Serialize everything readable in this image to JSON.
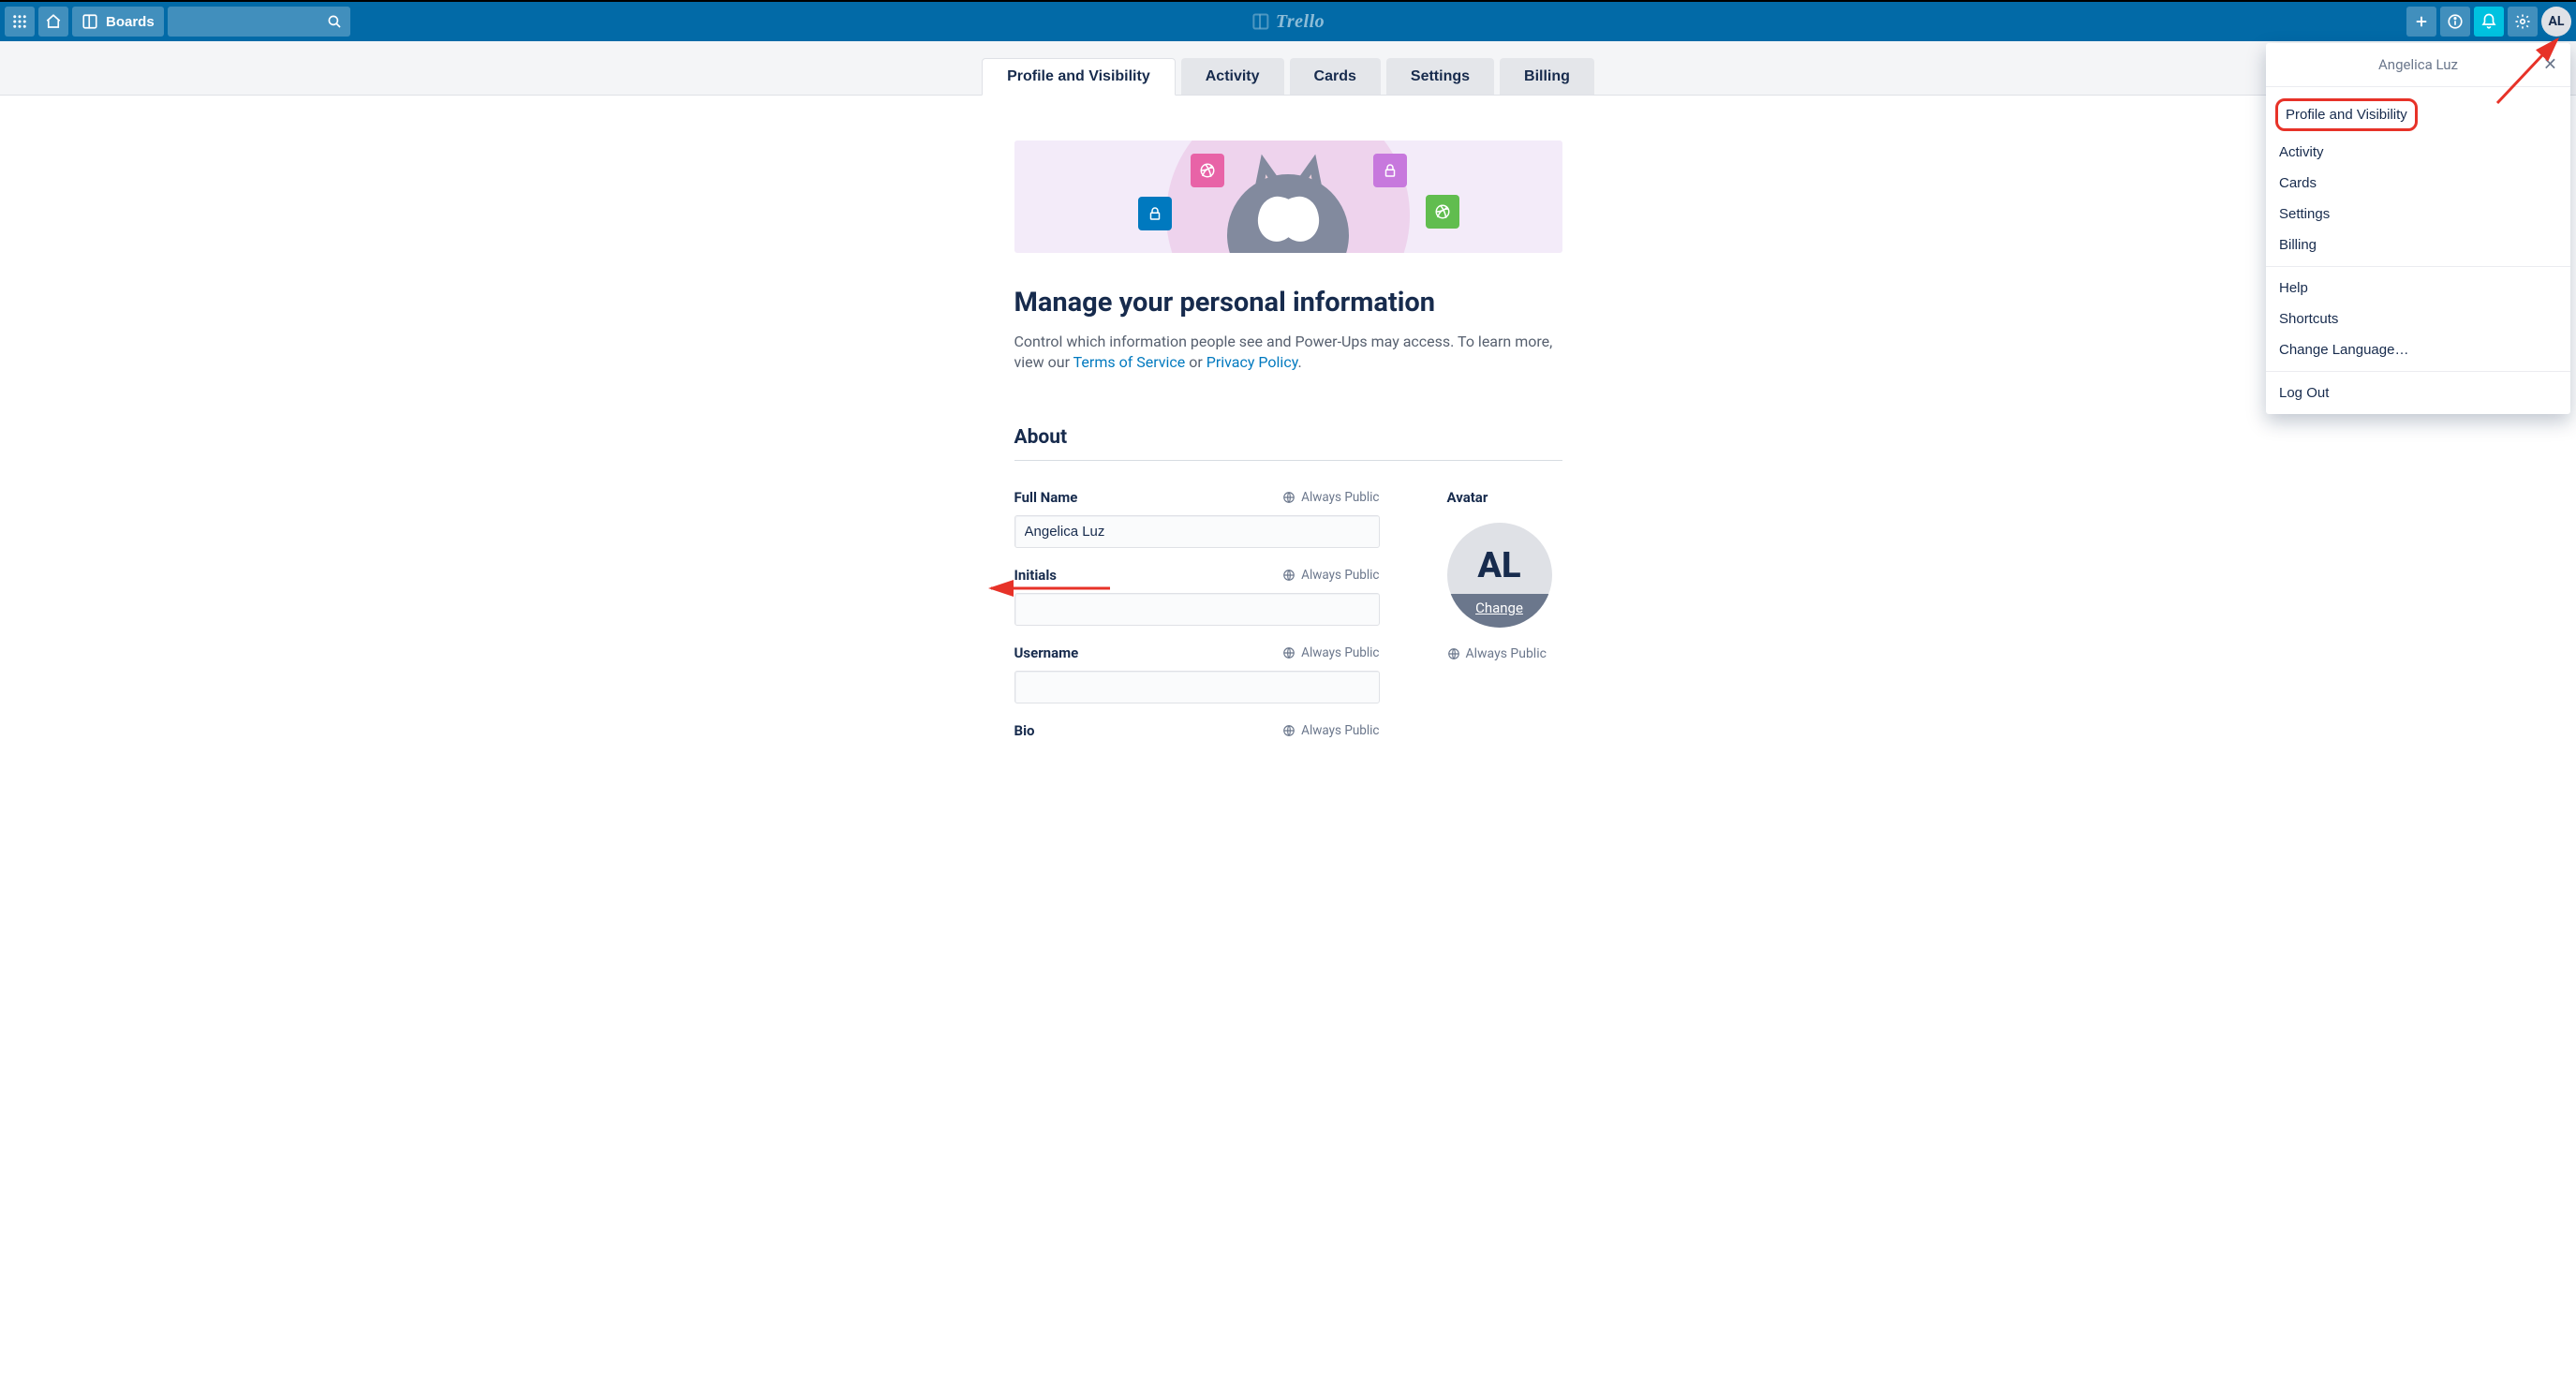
{
  "header": {
    "boards_label": "Boards",
    "logo_text": "Trello",
    "avatar_initials": "AL"
  },
  "tabs": [
    {
      "key": "profile",
      "label": "Profile and Visibility",
      "active": true
    },
    {
      "key": "activity",
      "label": "Activity",
      "active": false
    },
    {
      "key": "cards",
      "label": "Cards",
      "active": false
    },
    {
      "key": "settings",
      "label": "Settings",
      "active": false
    },
    {
      "key": "billing",
      "label": "Billing",
      "active": false
    }
  ],
  "page": {
    "title": "Manage your personal information",
    "desc_1": "Control which information people see and Power-Ups may access. To learn more, view our ",
    "tos_link": "Terms of Service",
    "desc_or": " or ",
    "pp_link": "Privacy Policy",
    "desc_dot": "."
  },
  "about": {
    "section_title": "About",
    "always_public": "Always Public",
    "full_name_label": "Full Name",
    "full_name_value": "Angelica Luz",
    "initials_label": "Initials",
    "initials_value": "",
    "username_label": "Username",
    "username_value": "",
    "bio_label": "Bio",
    "avatar_label": "Avatar",
    "avatar_initials": "AL",
    "avatar_change": "Change"
  },
  "popover": {
    "title": "Angelica Luz",
    "sections": [
      [
        {
          "key": "profile",
          "label": "Profile and Visibility",
          "highlight": true
        },
        {
          "key": "activity",
          "label": "Activity"
        },
        {
          "key": "cards",
          "label": "Cards"
        },
        {
          "key": "settings",
          "label": "Settings"
        },
        {
          "key": "billing",
          "label": "Billing"
        }
      ],
      [
        {
          "key": "help",
          "label": "Help"
        },
        {
          "key": "shortcuts",
          "label": "Shortcuts"
        },
        {
          "key": "lang",
          "label": "Change Language…"
        }
      ],
      [
        {
          "key": "logout",
          "label": "Log Out"
        }
      ]
    ]
  },
  "colors": {
    "brand": "#026aa7",
    "accent_red": "#e73228",
    "notif": "#00c2e0"
  }
}
